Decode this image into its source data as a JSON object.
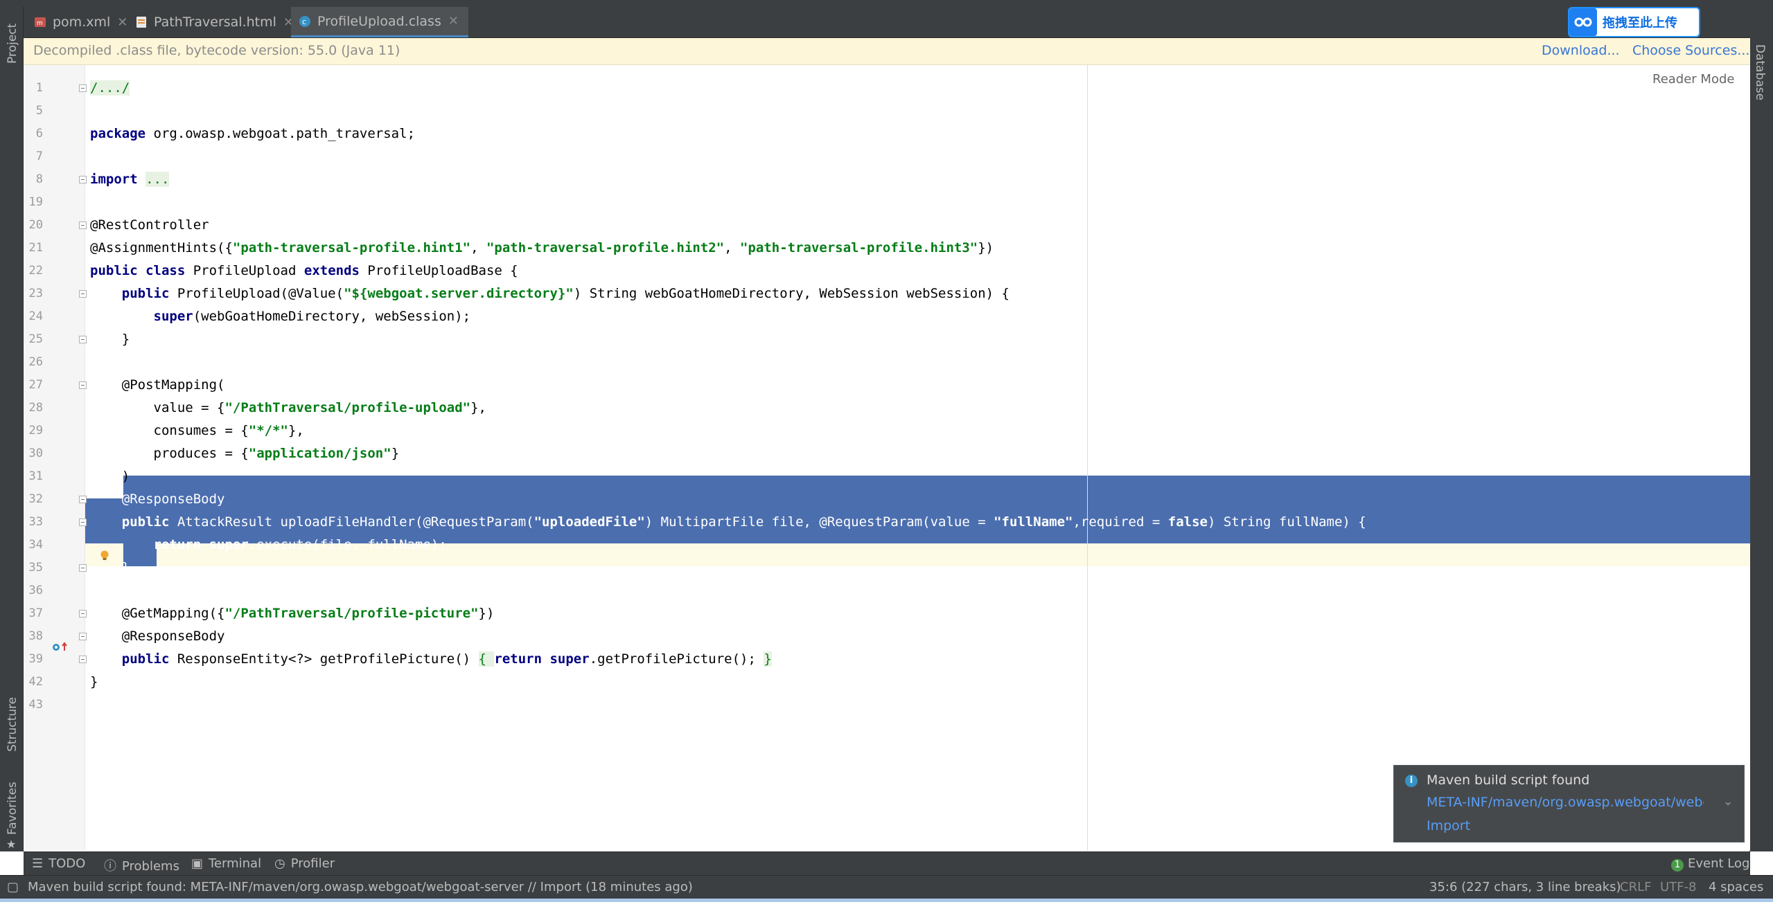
{
  "sidebar_left": {
    "project_label": "Project",
    "structure_label": "Structure",
    "favorites_label": "Favorites"
  },
  "sidebar_right": {
    "database_label": "Database"
  },
  "tabs": [
    {
      "label": "pom.xml",
      "icon": "maven-file-icon",
      "active": false
    },
    {
      "label": "PathTraversal.html",
      "icon": "html-file-icon",
      "active": false
    },
    {
      "label": "ProfileUpload.class",
      "icon": "class-file-icon",
      "active": true
    }
  ],
  "upload_badge": {
    "label": "拖拽至此上传"
  },
  "banner": {
    "text": "Decompiled .class file, bytecode version: 55.0 (Java 11)",
    "download": "Download...",
    "choose_sources": "Choose Sources..."
  },
  "editor": {
    "reader_mode": "Reader Mode"
  },
  "code_lines": [
    {
      "num": "1",
      "tokens": [
        {
          "t": "/.../",
          "c": "fold-box"
        }
      ]
    },
    {
      "num": "5",
      "tokens": []
    },
    {
      "num": "6",
      "tokens": [
        {
          "t": "package",
          "c": "kw"
        },
        {
          "t": " org.owasp.webgoat.path_traversal;",
          "c": ""
        }
      ]
    },
    {
      "num": "7",
      "tokens": []
    },
    {
      "num": "8",
      "tokens": [
        {
          "t": "import",
          "c": "kw"
        },
        {
          "t": " ",
          "c": ""
        },
        {
          "t": "...",
          "c": "fold-box"
        }
      ]
    },
    {
      "num": "19",
      "tokens": []
    },
    {
      "num": "20",
      "tokens": [
        {
          "t": "@RestController",
          "c": ""
        }
      ]
    },
    {
      "num": "21",
      "tokens": [
        {
          "t": "@AssignmentHints({",
          "c": ""
        },
        {
          "t": "\"path-traversal-profile.hint1\"",
          "c": "str"
        },
        {
          "t": ", ",
          "c": ""
        },
        {
          "t": "\"path-traversal-profile.hint2\"",
          "c": "str"
        },
        {
          "t": ", ",
          "c": ""
        },
        {
          "t": "\"path-traversal-profile.hint3\"",
          "c": "str"
        },
        {
          "t": "})",
          "c": ""
        }
      ]
    },
    {
      "num": "22",
      "tokens": [
        {
          "t": "public class",
          "c": "kw"
        },
        {
          "t": " ProfileUpload ",
          "c": ""
        },
        {
          "t": "extends",
          "c": "kw"
        },
        {
          "t": " ProfileUploadBase {",
          "c": ""
        }
      ]
    },
    {
      "num": "23",
      "tokens": [
        {
          "t": "    ",
          "c": ""
        },
        {
          "t": "public",
          "c": "kw"
        },
        {
          "t": " ProfileUpload(@Value(",
          "c": ""
        },
        {
          "t": "\"${webgoat.server.directory}\"",
          "c": "str"
        },
        {
          "t": ") String webGoatHomeDirectory, WebSession webSession) {",
          "c": ""
        }
      ]
    },
    {
      "num": "24",
      "tokens": [
        {
          "t": "        ",
          "c": ""
        },
        {
          "t": "super",
          "c": "kw"
        },
        {
          "t": "(webGoatHomeDirectory, webSession);",
          "c": ""
        }
      ]
    },
    {
      "num": "25",
      "tokens": [
        {
          "t": "    }",
          "c": ""
        }
      ]
    },
    {
      "num": "26",
      "tokens": []
    },
    {
      "num": "27",
      "tokens": [
        {
          "t": "    @PostMapping(",
          "c": ""
        }
      ]
    },
    {
      "num": "28",
      "tokens": [
        {
          "t": "        value = {",
          "c": ""
        },
        {
          "t": "\"/PathTraversal/profile-upload\"",
          "c": "str"
        },
        {
          "t": "},",
          "c": ""
        }
      ]
    },
    {
      "num": "29",
      "tokens": [
        {
          "t": "        consumes = {",
          "c": ""
        },
        {
          "t": "\"*/*\"",
          "c": "str"
        },
        {
          "t": "},",
          "c": ""
        }
      ]
    },
    {
      "num": "30",
      "tokens": [
        {
          "t": "        produces = {",
          "c": ""
        },
        {
          "t": "\"application/json\"",
          "c": "str"
        },
        {
          "t": "}",
          "c": ""
        }
      ]
    },
    {
      "num": "31",
      "tokens": [
        {
          "t": "    )",
          "c": ""
        }
      ]
    },
    {
      "num": "32",
      "tokens": [
        {
          "t": "    @ResponseBody",
          "c": ""
        }
      ]
    },
    {
      "num": "33",
      "tokens": [
        {
          "t": "    ",
          "c": ""
        },
        {
          "t": "public",
          "c": "kw"
        },
        {
          "t": " AttackResult uploadFileHandler(@RequestParam(",
          "c": ""
        },
        {
          "t": "\"uploadedFile\"",
          "c": "str"
        },
        {
          "t": ") MultipartFile file, @RequestParam(value = ",
          "c": ""
        },
        {
          "t": "\"fullName\"",
          "c": "str"
        },
        {
          "t": ",required = ",
          "c": ""
        },
        {
          "t": "false",
          "c": "kw"
        },
        {
          "t": ") String fullName) {",
          "c": ""
        }
      ]
    },
    {
      "num": "34",
      "tokens": [
        {
          "t": "        ",
          "c": ""
        },
        {
          "t": "return super",
          "c": "kw"
        },
        {
          "t": ".execute(file, fullName);",
          "c": ""
        }
      ]
    },
    {
      "num": "35",
      "tokens": [
        {
          "t": "    }",
          "c": ""
        }
      ]
    },
    {
      "num": "36",
      "tokens": []
    },
    {
      "num": "37",
      "tokens": [
        {
          "t": "    @GetMapping({",
          "c": ""
        },
        {
          "t": "\"/PathTraversal/profile-picture\"",
          "c": "str"
        },
        {
          "t": "})",
          "c": ""
        }
      ]
    },
    {
      "num": "38",
      "tokens": [
        {
          "t": "    @ResponseBody",
          "c": ""
        }
      ]
    },
    {
      "num": "39",
      "tokens": [
        {
          "t": "    ",
          "c": ""
        },
        {
          "t": "public",
          "c": "kw"
        },
        {
          "t": " ResponseEntity<?> getProfilePicture() ",
          "c": ""
        },
        {
          "t": "{ ",
          "c": "fold-box"
        },
        {
          "t": "return super",
          "c": "kw"
        },
        {
          "t": ".getProfilePicture(); ",
          "c": ""
        },
        {
          "t": "}",
          "c": "fold-box"
        }
      ]
    },
    {
      "num": "42",
      "tokens": [
        {
          "t": "}",
          "c": ""
        }
      ]
    },
    {
      "num": "43",
      "tokens": []
    }
  ],
  "tool_windows": [
    {
      "label": "TODO",
      "icon": "list-icon"
    },
    {
      "label": "Problems",
      "icon": "info-icon"
    },
    {
      "label": "Terminal",
      "icon": "terminal-icon"
    },
    {
      "label": "Profiler",
      "icon": "profiler-icon"
    }
  ],
  "event_log": {
    "count": "1",
    "label": "Event Log"
  },
  "status": {
    "message": "Maven build script found: META-INF/maven/org.owasp.webgoat/webgoat-server // Import (18 minutes ago)",
    "position": "35:6 (227 chars, 3 line breaks)",
    "line_sep": "CRLF",
    "encoding": "UTF-8",
    "indent": "4 spaces"
  },
  "notification": {
    "title": "Maven build script found",
    "path": "META-INF/maven/org.owasp.webgoat/webgoat-server",
    "action": "Import"
  },
  "colors": {
    "selection": "#4b6eaf",
    "keyword": "#000080",
    "string": "#067d17",
    "link": "#3875d6"
  }
}
